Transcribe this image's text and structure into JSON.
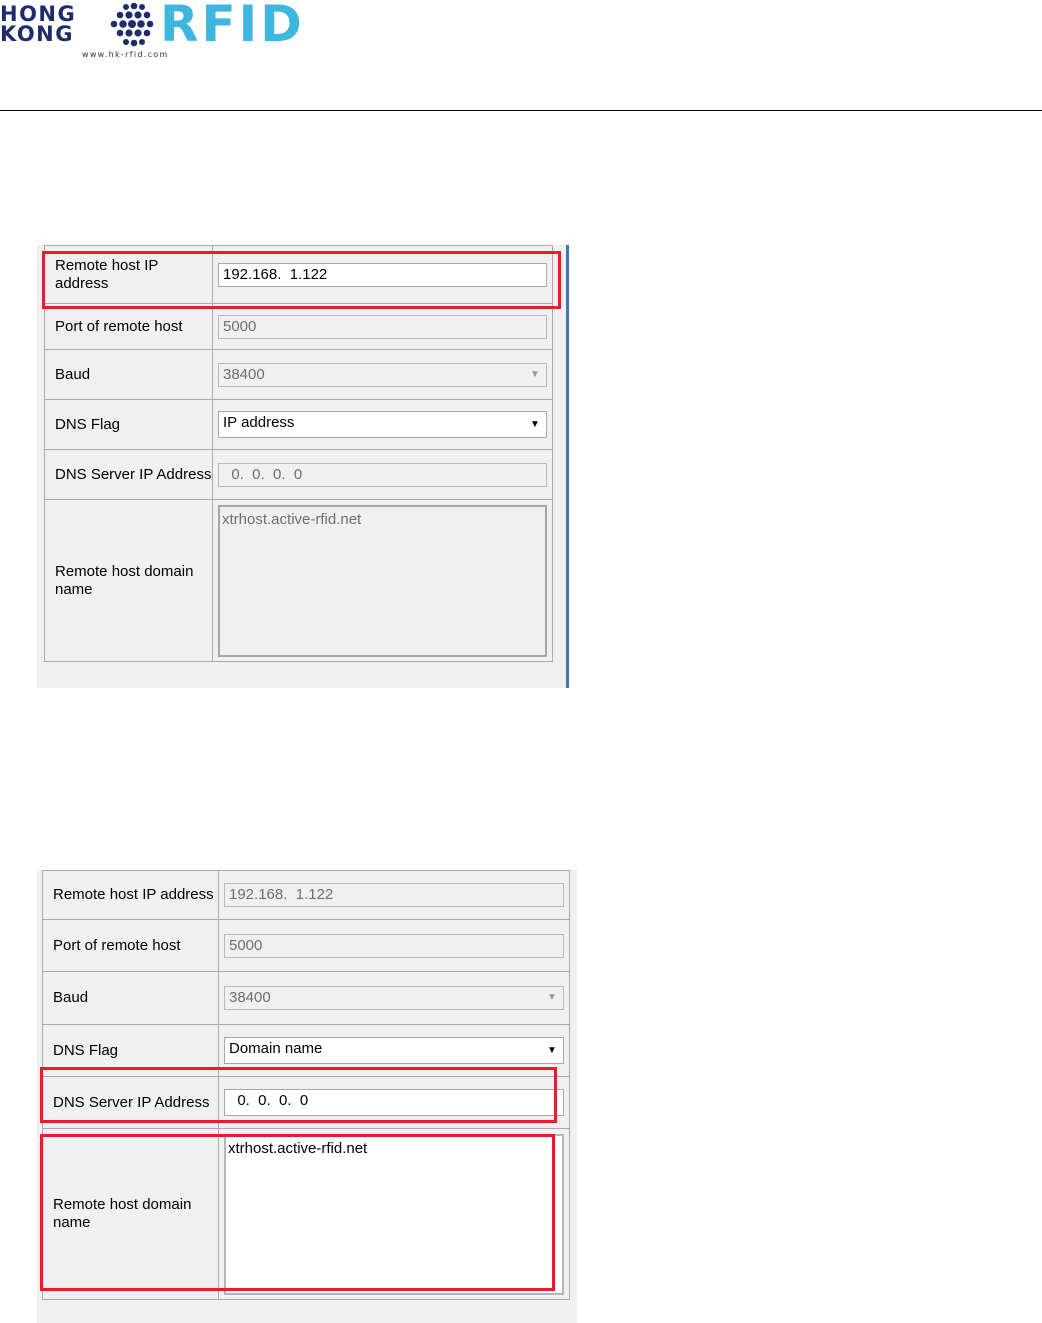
{
  "header": {
    "logo_line1": "HONG",
    "logo_line2": "KONG",
    "logo_brand": "RFID",
    "logo_url": "www.hk-rfid.com"
  },
  "colors": {
    "highlight": "#e0202a",
    "logo_navy": "#1f2c6b",
    "logo_blue": "#3fb6df"
  },
  "icons": {
    "dropdown": "dropdown-arrow-icon"
  },
  "screens": [
    {
      "fields": {
        "remote_ip": {
          "label": "Remote host IP address",
          "value": "192.168.  1.122"
        },
        "port": {
          "label": "Port of remote host",
          "value": "5000"
        },
        "baud": {
          "label": "Baud",
          "value": "38400"
        },
        "dns_flag": {
          "label": "DNS Flag",
          "value": "IP address"
        },
        "dns_server": {
          "label": "DNS Server IP Address",
          "value": "  0.  0.  0.  0"
        },
        "domain": {
          "label": "Remote host domain name",
          "value": "xtrhost.active-rfid.net"
        }
      }
    },
    {
      "fields": {
        "remote_ip": {
          "label": "Remote host IP address",
          "value": "192.168.  1.122"
        },
        "port": {
          "label": "Port of remote host",
          "value": "5000"
        },
        "baud": {
          "label": "Baud",
          "value": "38400"
        },
        "dns_flag": {
          "label": "DNS Flag",
          "value": "Domain name"
        },
        "dns_server": {
          "label": "DNS Server IP Address",
          "value": "  0.  0.  0.  0"
        },
        "domain": {
          "label": "Remote host domain name",
          "value": "xtrhost.active-rfid.net"
        }
      }
    }
  ]
}
